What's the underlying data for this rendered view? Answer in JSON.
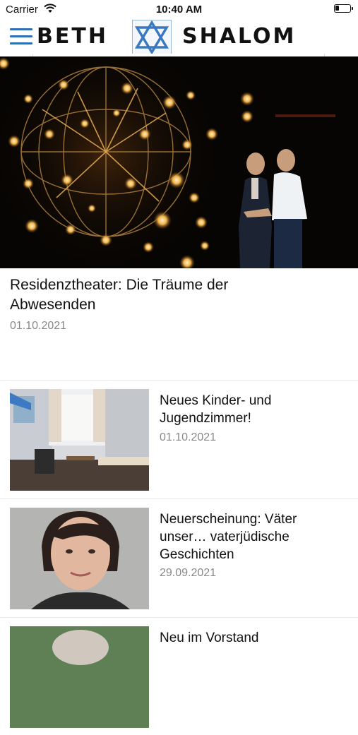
{
  "status_bar": {
    "carrier": "Carrier",
    "time": "10:40 AM"
  },
  "header": {
    "logo_left": "BETH",
    "logo_right": "SHALOM",
    "menu_icon": "hamburger-icon",
    "brand_color": "#2f6fb5"
  },
  "hero": {
    "title": "Residenztheater: Die Träume der Abwesenden",
    "date": "01.10.2021"
  },
  "articles": [
    {
      "title": "Neues Kinder- und Jugendzimmer!",
      "date": "01.10.2021"
    },
    {
      "title": "Neuerscheinung: Väter unser… vaterjüdische Geschichten",
      "date": "29.09.2021"
    },
    {
      "title": "Neu im Vorstand",
      "date": ""
    }
  ]
}
